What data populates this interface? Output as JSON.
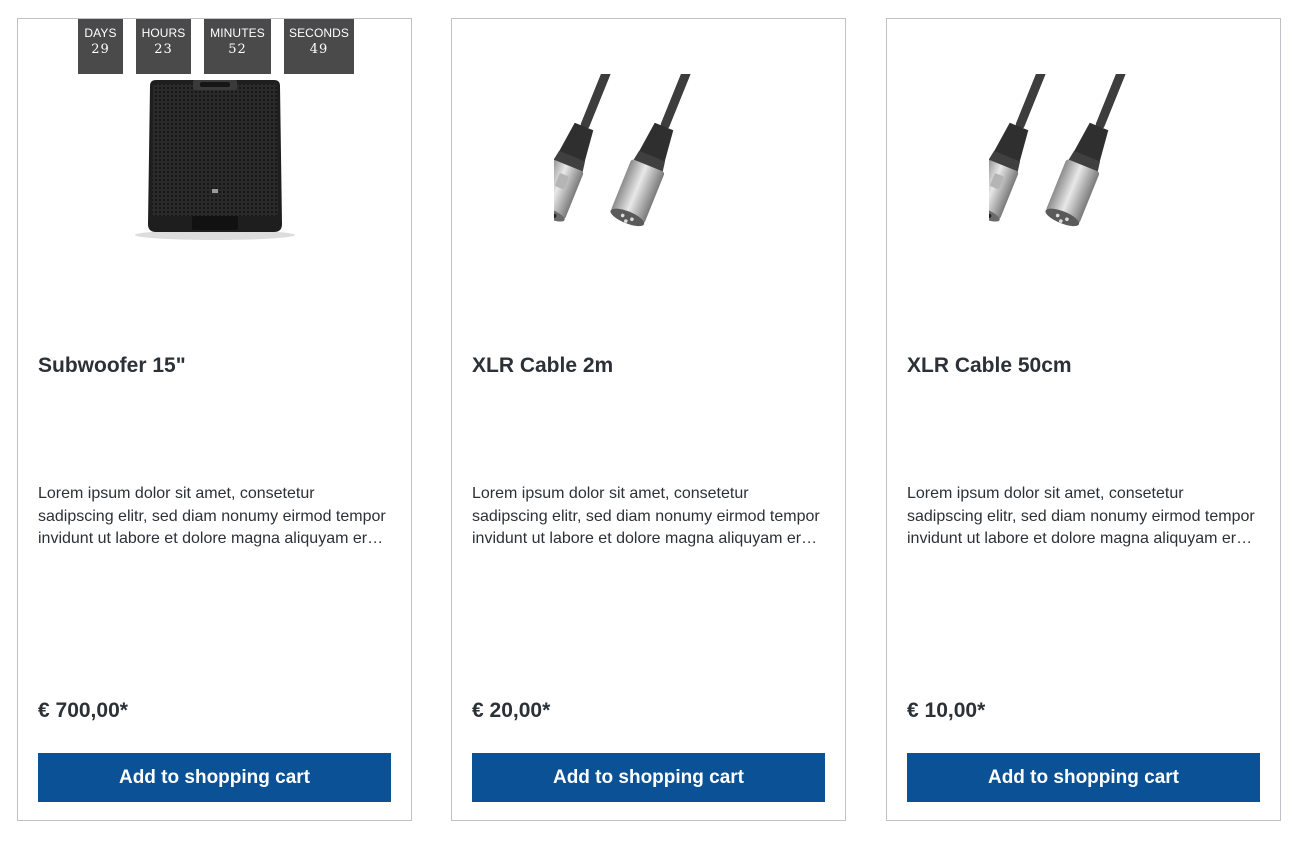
{
  "countdown": {
    "days_label": "DAYS",
    "days_value": "29",
    "hours_label": "HOURS",
    "hours_value": "23",
    "minutes_label": "MINUTES",
    "minutes_value": "52",
    "seconds_label": "SECONDS",
    "seconds_value": "49"
  },
  "products": [
    {
      "name": "Subwoofer 15\"",
      "image_icon": "subwoofer-speaker",
      "description": "Lorem ipsum dolor sit amet, consetetur sadipscing elitr, sed diam nonumy eirmod tempor invidunt ut labore et dolore magna aliquyam erat, sed diam voluptua.",
      "price": "€ 700,00*",
      "button_label": "Add to shopping cart"
    },
    {
      "name": "XLR Cable 2m",
      "image_icon": "xlr-cable",
      "description": "Lorem ipsum dolor sit amet, consetetur sadipscing elitr, sed diam nonumy eirmod tempor invidunt ut labore et dolore magna aliquyam erat, sed diam voluptua.",
      "price": "€ 20,00*",
      "button_label": "Add to shopping cart"
    },
    {
      "name": "XLR Cable 50cm",
      "image_icon": "xlr-cable",
      "description": "Lorem ipsum dolor sit amet, consetetur sadipscing elitr, sed diam nonumy eirmod tempor invidunt ut labore et dolore magna aliquyam erat, sed diam voluptua.",
      "price": "€ 10,00*",
      "button_label": "Add to shopping cart"
    }
  ],
  "colors": {
    "button": "#0b5196",
    "countdown_bg": "#4a4a4a",
    "text": "#2b3136",
    "border": "#bfc3c7"
  }
}
